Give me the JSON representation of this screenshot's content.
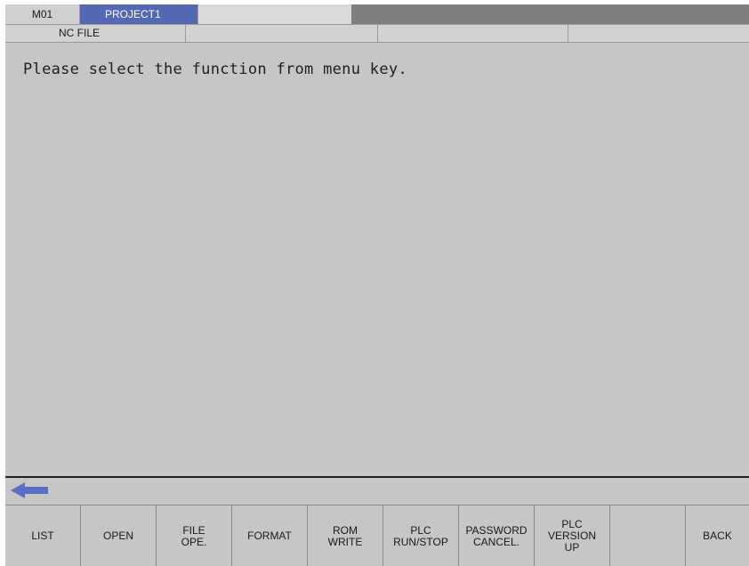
{
  "header": {
    "machine": "M01",
    "project": "PROJECT1",
    "screen_name": "NC FILE"
  },
  "main": {
    "message": "Please select the function from menu key."
  },
  "prompt": {
    "icon": "left-arrow-icon",
    "icon_color": "#5b6fc8"
  },
  "menu_keys": [
    {
      "label": "LIST"
    },
    {
      "label": "OPEN"
    },
    {
      "label": "FILE\nOPE."
    },
    {
      "label": "FORMAT"
    },
    {
      "label": "ROM\nWRITE"
    },
    {
      "label": "PLC\nRUN/STOP"
    },
    {
      "label": "PASSWORD\nCANCEL."
    },
    {
      "label": "PLC\nVERSION\nUP"
    },
    {
      "label": ""
    },
    {
      "label": "BACK"
    }
  ],
  "colors": {
    "background": "#c6c6c6",
    "project_tab": "#5468b4",
    "header_bar": "#7f7f7f"
  }
}
